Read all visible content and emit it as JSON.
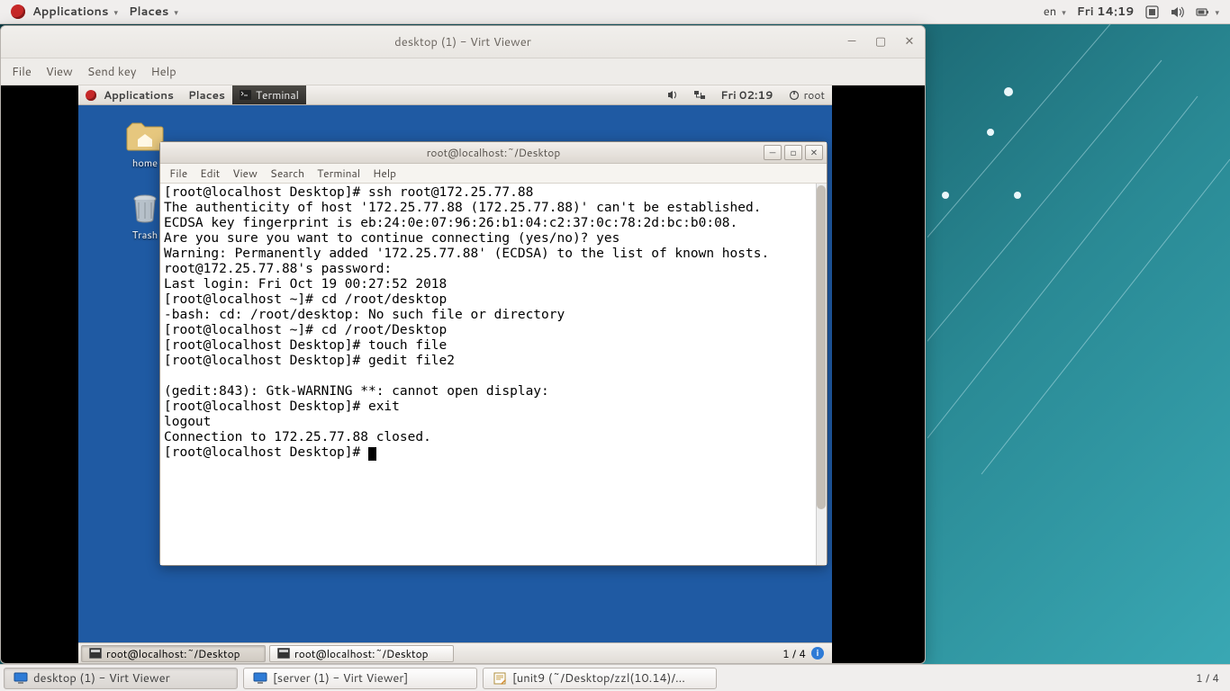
{
  "host_panel": {
    "applications": "Applications",
    "places": "Places",
    "lang": "en",
    "clock": "Fri 14:19"
  },
  "host_taskbar": {
    "items": [
      {
        "label": "desktop (1) - Virt Viewer",
        "active": true
      },
      {
        "label": "[server (1) - Virt Viewer]",
        "active": false
      },
      {
        "label": "[unit9 (~/Desktop/zzl(10.14)/...",
        "active": false
      }
    ],
    "workspace": "1 / 4"
  },
  "virt_viewer": {
    "title": "desktop (1) - Virt Viewer",
    "menu": [
      "File",
      "View",
      "Send key",
      "Help"
    ]
  },
  "guest_panel": {
    "applications": "Applications",
    "places": "Places",
    "terminal": "Terminal",
    "clock": "Fri 02:19",
    "user": "root"
  },
  "guest_desktop": {
    "home": "home",
    "trash": "Trash"
  },
  "guest_taskbar": {
    "items": [
      {
        "label": "root@localhost:~/Desktop",
        "active": true
      },
      {
        "label": "root@localhost:~/Desktop",
        "active": false
      }
    ],
    "workspace": "1 / 4"
  },
  "terminal": {
    "title": "root@localhost:~/Desktop",
    "menu": [
      "File",
      "Edit",
      "View",
      "Search",
      "Terminal",
      "Help"
    ],
    "lines": [
      "[root@localhost Desktop]# ssh root@172.25.77.88",
      "The authenticity of host '172.25.77.88 (172.25.77.88)' can't be established.",
      "ECDSA key fingerprint is eb:24:0e:07:96:26:b1:04:c2:37:0c:78:2d:bc:b0:08.",
      "Are you sure you want to continue connecting (yes/no)? yes",
      "Warning: Permanently added '172.25.77.88' (ECDSA) to the list of known hosts.",
      "root@172.25.77.88's password: ",
      "Last login: Fri Oct 19 00:27:52 2018",
      "[root@localhost ~]# cd /root/desktop",
      "-bash: cd: /root/desktop: No such file or directory",
      "[root@localhost ~]# cd /root/Desktop",
      "[root@localhost Desktop]# touch file",
      "[root@localhost Desktop]# gedit file2",
      "",
      "(gedit:843): Gtk-WARNING **: cannot open display: ",
      "[root@localhost Desktop]# exit",
      "logout",
      "Connection to 172.25.77.88 closed.",
      "[root@localhost Desktop]# "
    ]
  }
}
